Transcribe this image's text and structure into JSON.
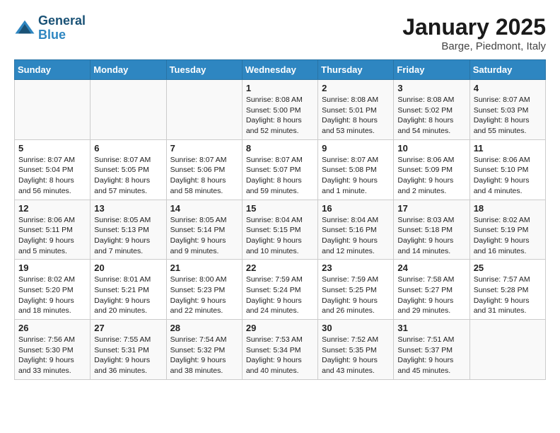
{
  "logo": {
    "line1": "General",
    "line2": "Blue"
  },
  "title": "January 2025",
  "location": "Barge, Piedmont, Italy",
  "days_of_week": [
    "Sunday",
    "Monday",
    "Tuesday",
    "Wednesday",
    "Thursday",
    "Friday",
    "Saturday"
  ],
  "weeks": [
    [
      {
        "day": "",
        "info": ""
      },
      {
        "day": "",
        "info": ""
      },
      {
        "day": "",
        "info": ""
      },
      {
        "day": "1",
        "info": "Sunrise: 8:08 AM\nSunset: 5:00 PM\nDaylight: 8 hours\nand 52 minutes."
      },
      {
        "day": "2",
        "info": "Sunrise: 8:08 AM\nSunset: 5:01 PM\nDaylight: 8 hours\nand 53 minutes."
      },
      {
        "day": "3",
        "info": "Sunrise: 8:08 AM\nSunset: 5:02 PM\nDaylight: 8 hours\nand 54 minutes."
      },
      {
        "day": "4",
        "info": "Sunrise: 8:07 AM\nSunset: 5:03 PM\nDaylight: 8 hours\nand 55 minutes."
      }
    ],
    [
      {
        "day": "5",
        "info": "Sunrise: 8:07 AM\nSunset: 5:04 PM\nDaylight: 8 hours\nand 56 minutes."
      },
      {
        "day": "6",
        "info": "Sunrise: 8:07 AM\nSunset: 5:05 PM\nDaylight: 8 hours\nand 57 minutes."
      },
      {
        "day": "7",
        "info": "Sunrise: 8:07 AM\nSunset: 5:06 PM\nDaylight: 8 hours\nand 58 minutes."
      },
      {
        "day": "8",
        "info": "Sunrise: 8:07 AM\nSunset: 5:07 PM\nDaylight: 8 hours\nand 59 minutes."
      },
      {
        "day": "9",
        "info": "Sunrise: 8:07 AM\nSunset: 5:08 PM\nDaylight: 9 hours\nand 1 minute."
      },
      {
        "day": "10",
        "info": "Sunrise: 8:06 AM\nSunset: 5:09 PM\nDaylight: 9 hours\nand 2 minutes."
      },
      {
        "day": "11",
        "info": "Sunrise: 8:06 AM\nSunset: 5:10 PM\nDaylight: 9 hours\nand 4 minutes."
      }
    ],
    [
      {
        "day": "12",
        "info": "Sunrise: 8:06 AM\nSunset: 5:11 PM\nDaylight: 9 hours\nand 5 minutes."
      },
      {
        "day": "13",
        "info": "Sunrise: 8:05 AM\nSunset: 5:13 PM\nDaylight: 9 hours\nand 7 minutes."
      },
      {
        "day": "14",
        "info": "Sunrise: 8:05 AM\nSunset: 5:14 PM\nDaylight: 9 hours\nand 9 minutes."
      },
      {
        "day": "15",
        "info": "Sunrise: 8:04 AM\nSunset: 5:15 PM\nDaylight: 9 hours\nand 10 minutes."
      },
      {
        "day": "16",
        "info": "Sunrise: 8:04 AM\nSunset: 5:16 PM\nDaylight: 9 hours\nand 12 minutes."
      },
      {
        "day": "17",
        "info": "Sunrise: 8:03 AM\nSunset: 5:18 PM\nDaylight: 9 hours\nand 14 minutes."
      },
      {
        "day": "18",
        "info": "Sunrise: 8:02 AM\nSunset: 5:19 PM\nDaylight: 9 hours\nand 16 minutes."
      }
    ],
    [
      {
        "day": "19",
        "info": "Sunrise: 8:02 AM\nSunset: 5:20 PM\nDaylight: 9 hours\nand 18 minutes."
      },
      {
        "day": "20",
        "info": "Sunrise: 8:01 AM\nSunset: 5:21 PM\nDaylight: 9 hours\nand 20 minutes."
      },
      {
        "day": "21",
        "info": "Sunrise: 8:00 AM\nSunset: 5:23 PM\nDaylight: 9 hours\nand 22 minutes."
      },
      {
        "day": "22",
        "info": "Sunrise: 7:59 AM\nSunset: 5:24 PM\nDaylight: 9 hours\nand 24 minutes."
      },
      {
        "day": "23",
        "info": "Sunrise: 7:59 AM\nSunset: 5:25 PM\nDaylight: 9 hours\nand 26 minutes."
      },
      {
        "day": "24",
        "info": "Sunrise: 7:58 AM\nSunset: 5:27 PM\nDaylight: 9 hours\nand 29 minutes."
      },
      {
        "day": "25",
        "info": "Sunrise: 7:57 AM\nSunset: 5:28 PM\nDaylight: 9 hours\nand 31 minutes."
      }
    ],
    [
      {
        "day": "26",
        "info": "Sunrise: 7:56 AM\nSunset: 5:30 PM\nDaylight: 9 hours\nand 33 minutes."
      },
      {
        "day": "27",
        "info": "Sunrise: 7:55 AM\nSunset: 5:31 PM\nDaylight: 9 hours\nand 36 minutes."
      },
      {
        "day": "28",
        "info": "Sunrise: 7:54 AM\nSunset: 5:32 PM\nDaylight: 9 hours\nand 38 minutes."
      },
      {
        "day": "29",
        "info": "Sunrise: 7:53 AM\nSunset: 5:34 PM\nDaylight: 9 hours\nand 40 minutes."
      },
      {
        "day": "30",
        "info": "Sunrise: 7:52 AM\nSunset: 5:35 PM\nDaylight: 9 hours\nand 43 minutes."
      },
      {
        "day": "31",
        "info": "Sunrise: 7:51 AM\nSunset: 5:37 PM\nDaylight: 9 hours\nand 45 minutes."
      },
      {
        "day": "",
        "info": ""
      }
    ]
  ]
}
